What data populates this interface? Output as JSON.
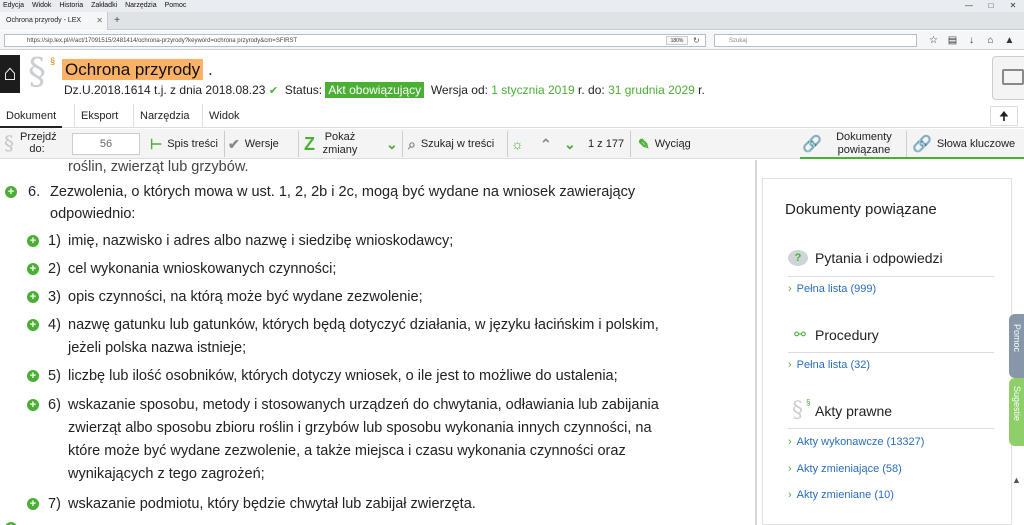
{
  "browser": {
    "menu": [
      "Edycja",
      "Widok",
      "Historia",
      "Zakładki",
      "Narzędzia",
      "Pomoc"
    ],
    "tab_title": "Ochrona przyrody - LEX",
    "url": "https://sip.lex.pl/#/act/17091515/2481414/ochrona-przyrody?keyword=ochrona przyrody&cm=SFIRST",
    "zoom": "180%",
    "search_placeholder": "Szukaj"
  },
  "header": {
    "title": "Ochrona przyrody",
    "title_dot": ".",
    "citation": "Dz.U.2018.1614 t.j. z dnia 2018.08.23",
    "status_label": "Status:",
    "status_value": "Akt obowiązujący",
    "version_label": "Wersja od:",
    "version_from": "1 stycznia 2019",
    "version_to_label": "r. do:",
    "version_to": "31 grudnia 2029",
    "version_end": "r."
  },
  "menu_tabs": [
    "Dokument",
    "Eksport",
    "Narzędzia",
    "Widok"
  ],
  "toolbar": {
    "goto_label": "Przejdź do:",
    "goto_value": "56",
    "toc": "Spis treści",
    "versions": "Wersje",
    "show_changes": "Pokaż zmiany",
    "search_in": "Szukaj w treści",
    "counter": "1 z 177",
    "extract": "Wyciąg",
    "related_docs": "Dokumenty powiązane",
    "keywords": "Słowa kluczowe"
  },
  "content": {
    "partial_top": "roślin, zwierząt lub grzybów.",
    "para6_num": "6.",
    "para6_line1": "Zezwolenia, o których mowa w ust. 1, 2, 2b i 2c, mogą być wydane na wniosek zawierający",
    "para6_line2": "odpowiednio:",
    "items": [
      {
        "num": "1)",
        "lines": [
          "imię, nazwisko i adres albo nazwę i siedzibę wnioskodawcy;"
        ]
      },
      {
        "num": "2)",
        "lines": [
          "cel wykonania wnioskowanych czynności;"
        ]
      },
      {
        "num": "3)",
        "lines": [
          "opis czynności, na którą może być wydane zezwolenie;"
        ]
      },
      {
        "num": "4)",
        "lines": [
          "nazwę gatunku lub gatunków, których będą dotyczyć działania, w języku łacińskim i polskim,",
          "jeżeli polska nazwa istnieje;"
        ]
      },
      {
        "num": "5)",
        "lines": [
          "liczbę lub ilość osobników, których dotyczy wniosek, o ile jest to możliwe do ustalenia;"
        ]
      },
      {
        "num": "6)",
        "lines": [
          "wskazanie sposobu, metody i stosowanych urządzeń do chwytania, odławiania lub zabijania",
          "zwierząt albo sposobu zbioru roślin i grzybów lub sposobu wykonania innych czynności, na",
          "które może być wydane zezwolenie, a także miejsca i czasu wykonania czynności oraz",
          "wynikających z tego zagrożeń;"
        ]
      },
      {
        "num": "7)",
        "lines": [
          "wskazanie podmiotu, który będzie chwytał lub zabijał zwierzęta."
        ]
      }
    ]
  },
  "right_panel": {
    "title": "Dokumenty powiązane",
    "qa_title": "Pytania i odpowiedzi",
    "qa_link": "Pełna lista (999)",
    "proc_title": "Procedury",
    "proc_link": "Pełna lista (32)",
    "acts_title": "Akty prawne",
    "acts_links": [
      "Akty wykonawcze (13327)",
      "Akty zmieniające (58)",
      "Akty zmieniane (10)"
    ]
  },
  "side_tabs": {
    "help": "Pomoc",
    "suggestions": "Sugestie"
  },
  "colors": {
    "accent_green": "#4caf35",
    "title_highlight": "#fbb267",
    "link_blue": "#2a6ebb"
  }
}
